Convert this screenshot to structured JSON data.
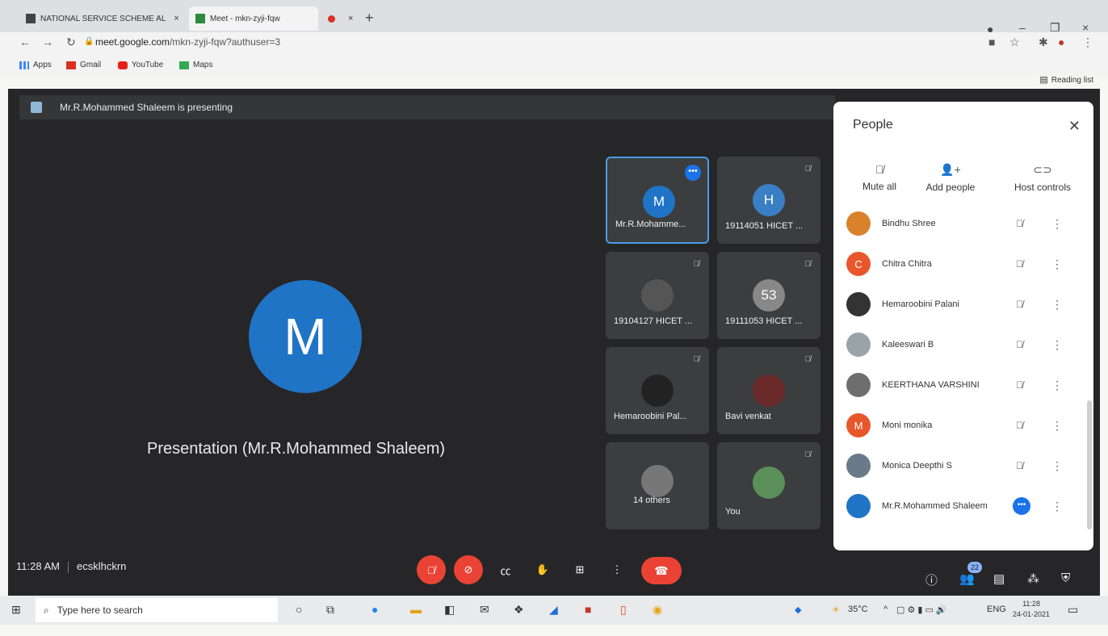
{
  "browser": {
    "tabs": [
      {
        "label": "NATIONAL SERVICE SCHEME AL",
        "close": "×"
      },
      {
        "label": "Meet - mkn-zyji-fqw",
        "close": ""
      },
      {
        "label": "",
        "close": "×"
      }
    ],
    "new_tab": "+",
    "window_controls": [
      "–",
      "❐",
      "×"
    ],
    "url_host": "meet.google.com",
    "url_path": "/mkn-zyji-fqw?authuser=3",
    "bookmarks": [
      "Apps",
      "Gmail",
      "YouTube",
      "Maps"
    ],
    "reading_list": "Reading list"
  },
  "meet": {
    "presenting_banner": "Mr.R.Mohammed Shaleem is presenting",
    "presenter_initial": "M",
    "presentation_caption": "Presentation (Mr.R.Mohammed Shaleem)",
    "tiles": [
      {
        "name": "Mr.R.Mohamme...",
        "initial": "M",
        "color": "#1f74c6"
      },
      {
        "name": "19114051 HICET ...",
        "initial": "H",
        "color": "#3a7fc4"
      },
      {
        "name": "19104127 HICET ...",
        "initial": "",
        "color": "#555"
      },
      {
        "name": "19111053 HICET ...",
        "initial": "53",
        "color": "#888"
      },
      {
        "name": "Hemaroobini Pal...",
        "initial": "",
        "color": "#222"
      },
      {
        "name": "Bavi venkat",
        "initial": "",
        "color": "#6b2a2a"
      },
      {
        "name": "14 others",
        "initial": "",
        "color": "#777"
      },
      {
        "name": "You",
        "initial": "",
        "color": "#5a8f5a"
      }
    ],
    "time": "11:28 AM",
    "meeting_code": "ecsklhckrn",
    "participant_count": "22"
  },
  "people_panel": {
    "title": "People",
    "actions": [
      "Mute all",
      "Add people",
      "Host controls"
    ],
    "participants": [
      {
        "name": "Bindhu Shree",
        "initial": "",
        "color": "#d9822b"
      },
      {
        "name": "Chitra Chitra",
        "initial": "C",
        "color": "#e8572c"
      },
      {
        "name": "Hemaroobini Palani",
        "initial": "",
        "color": "#333333"
      },
      {
        "name": "Kaleeswari B",
        "initial": "",
        "color": "#9aa3a8"
      },
      {
        "name": "KEERTHANA VARSHINI",
        "initial": "",
        "color": "#6e6e6e"
      },
      {
        "name": "Moni monika",
        "initial": "M",
        "color": "#e8572c"
      },
      {
        "name": "Monica Deepthi S",
        "initial": "",
        "color": "#6a7a8a"
      },
      {
        "name": "Mr.R.Mohammed Shaleem",
        "initial": "",
        "color": "#1f74c6"
      }
    ]
  },
  "taskbar": {
    "search_placeholder": "Type here to search",
    "temperature": "35°C",
    "language": "ENG",
    "time": "11:28",
    "date": "24-01-2021"
  }
}
